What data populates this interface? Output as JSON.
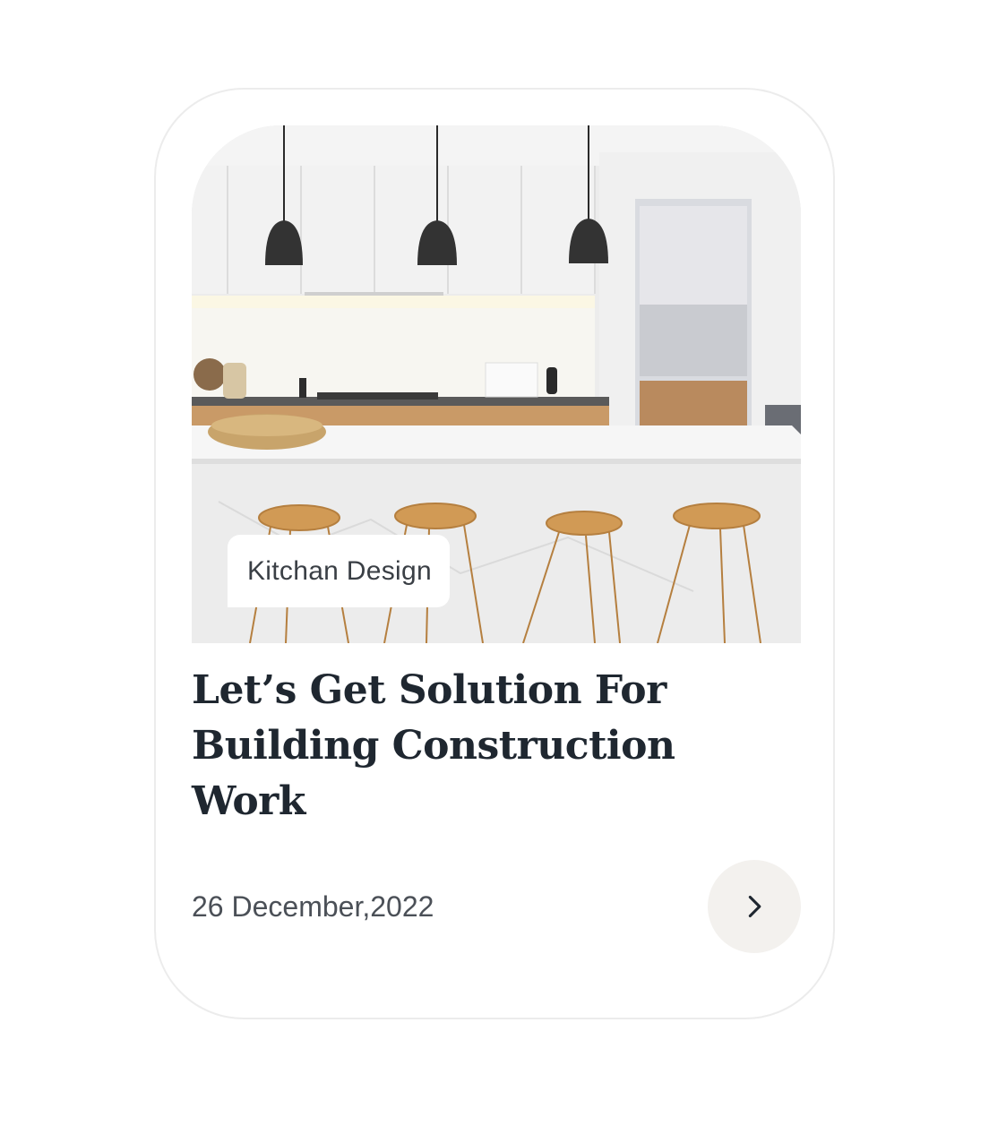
{
  "card": {
    "category_tag": "Kitchan Design",
    "title": "Let’s Get Solution For Building Construction Work",
    "date": "26 December,2022",
    "next_icon": "chevron-right-icon"
  },
  "colors": {
    "title": "#1f2730",
    "button_bg": "#f3f1ee",
    "card_border": "#ececec"
  }
}
